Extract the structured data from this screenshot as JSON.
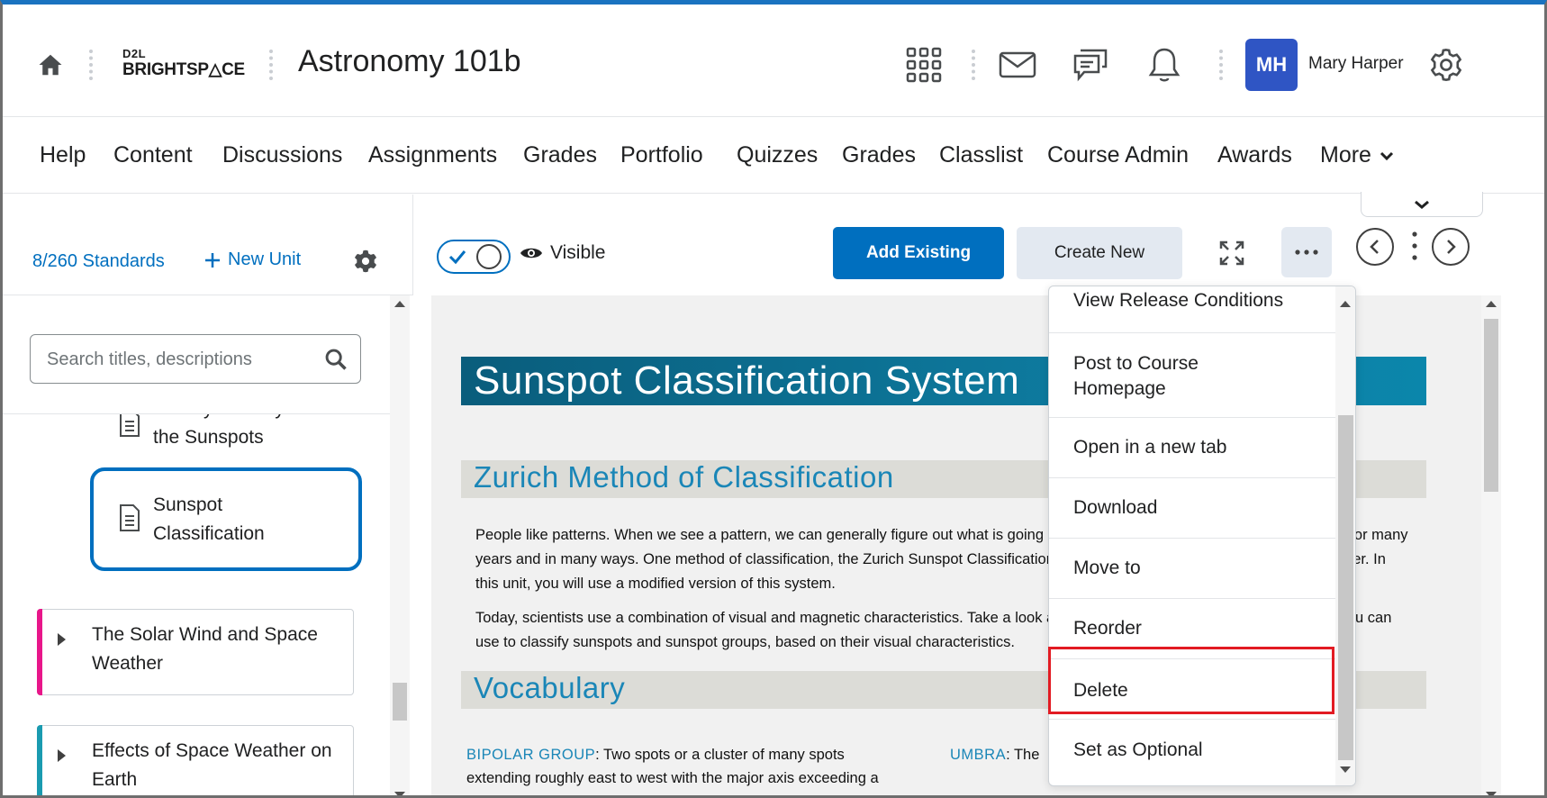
{
  "header": {
    "logo_top": "D2L",
    "logo_main": "BRIGHTSP△CE",
    "course_title": "Astronomy 101b",
    "user": {
      "initials": "MH",
      "name": "Mary Harper"
    },
    "icons": [
      "home-icon",
      "apps-grid-icon",
      "mail-icon",
      "chat-icon",
      "bell-icon",
      "gear-icon"
    ]
  },
  "nav": {
    "items": [
      "Help",
      "Content",
      "Discussions",
      "Assignments",
      "Grades",
      "Portfolio",
      "Quizzes",
      "Grades",
      "Classlist",
      "Course Admin",
      "Awards"
    ],
    "more_label": "More"
  },
  "left_panel": {
    "standards": "8/260 Standards",
    "new_unit": "New Unit",
    "search_placeholder": "Search titles, descriptions",
    "tree": {
      "partial_item_line1": "Activity: Identify",
      "partial_item_line2": "the Sunspots",
      "selected_item": "Sunspot Classification",
      "units": [
        {
          "label": "The Solar Wind and Space Weather",
          "color": "#e8168a"
        },
        {
          "label": "Effects of Space Weather on Earth",
          "color": "#1a9bb0"
        }
      ]
    }
  },
  "toolbar": {
    "visibility_label": "Visible",
    "add_existing": "Add Existing",
    "create_new": "Create New"
  },
  "content": {
    "title": "Sunspot Classification System",
    "section1": "Zurich Method of Classification",
    "para1": "People like patterns. When we see a pattern, we can generally figure out what is going on. Scientists have been classifying sunspots for many years and in many ways. One method of classification, the Zurich Sunspot Classification System, was devised in 1938 by M. Waldmeier. In this unit, you will use a modified version of this system.",
    "para2": "Today, scientists use a combination of visual and magnetic characteristics. Take a look at the Zurich Sunspot Classification scheme you can use to classify sunspots and sunspot groups, based on their visual characteristics.",
    "section2": "Vocabulary",
    "vocab1_term": "BIPOLAR GROUP",
    "vocab1_text": ": Two spots or a cluster of many spots",
    "vocab1_line2": "extending roughly east to west with the major axis exceeding a",
    "vocab2_term": "UMBRA",
    "vocab2_text": ": The"
  },
  "menu": {
    "items": [
      "View Release Conditions",
      "Post to Course Homepage",
      "Open in a new tab",
      "Download",
      "Move to",
      "Reorder",
      "Delete",
      "Set as Optional"
    ],
    "highlighted": "Delete"
  }
}
